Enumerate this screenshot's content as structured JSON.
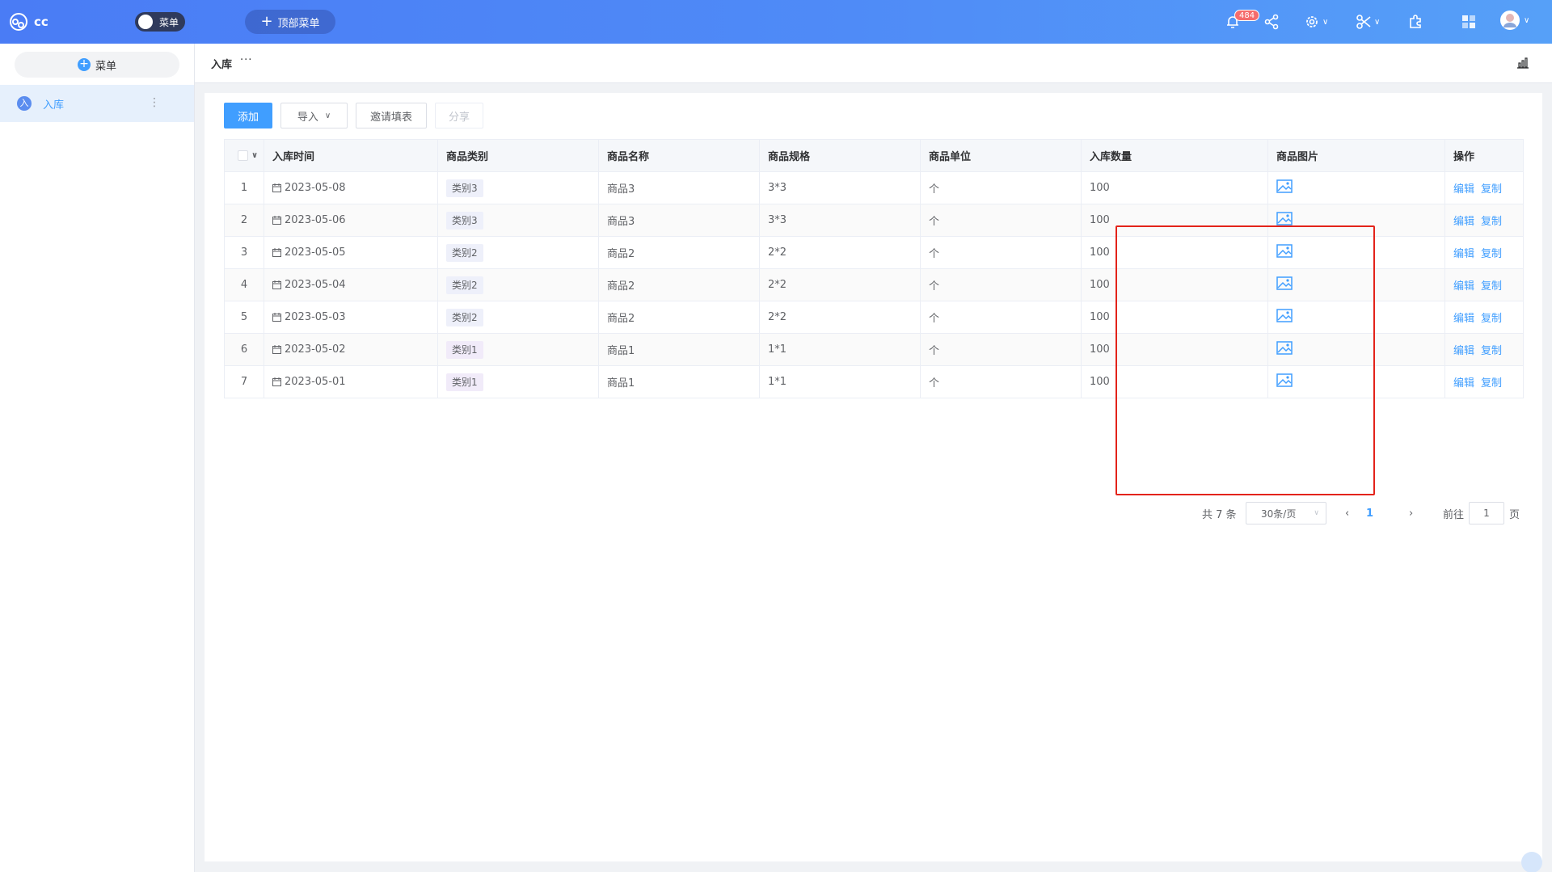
{
  "header": {
    "brand": "cc",
    "menu_toggle_label": "菜单",
    "top_menu_label": "顶部菜单",
    "notification_count": "484",
    "icons": [
      "bell-icon",
      "share-icon",
      "gear-icon",
      "tools-icon",
      "plugin-icon",
      "apps-icon",
      "avatar"
    ]
  },
  "sidebar": {
    "add_menu_label": "菜单",
    "items": [
      {
        "avatar": "入",
        "label": "入库"
      }
    ]
  },
  "page": {
    "title": "入库",
    "more": "···"
  },
  "toolbar": {
    "add_label": "添加",
    "import_label": "导入",
    "invite_label": "邀请填表",
    "share_label": "分享"
  },
  "table": {
    "columns": [
      "入库时间",
      "商品类别",
      "商品名称",
      "商品规格",
      "商品单位",
      "入库数量",
      "商品图片",
      "操作"
    ],
    "rows": [
      {
        "idx": "1",
        "date": "2023-05-08",
        "category": "类别3",
        "name": "商品3",
        "spec": "3*3",
        "unit": "个",
        "qty": "100"
      },
      {
        "idx": "2",
        "date": "2023-05-06",
        "category": "类别3",
        "name": "商品3",
        "spec": "3*3",
        "unit": "个",
        "qty": "100"
      },
      {
        "idx": "3",
        "date": "2023-05-05",
        "category": "类别2",
        "name": "商品2",
        "spec": "2*2",
        "unit": "个",
        "qty": "100"
      },
      {
        "idx": "4",
        "date": "2023-05-04",
        "category": "类别2",
        "name": "商品2",
        "spec": "2*2",
        "unit": "个",
        "qty": "100"
      },
      {
        "idx": "5",
        "date": "2023-05-03",
        "category": "类别2",
        "name": "商品2",
        "spec": "2*2",
        "unit": "个",
        "qty": "100"
      },
      {
        "idx": "6",
        "date": "2023-05-02",
        "category": "类别1",
        "name": "商品1",
        "spec": "1*1",
        "unit": "个",
        "qty": "100"
      },
      {
        "idx": "7",
        "date": "2023-05-01",
        "category": "类别1",
        "name": "商品1",
        "spec": "1*1",
        "unit": "个",
        "qty": "100"
      }
    ],
    "actions": {
      "edit": "编辑",
      "copy": "复制"
    }
  },
  "pagination": {
    "total": "共 7 条",
    "page_size": "30条/页",
    "current_page": "1",
    "goto_label": "前往",
    "goto_value": "1",
    "page_suffix": "页"
  },
  "colors": {
    "primary": "#409eff",
    "highlight": "#e3231a"
  }
}
